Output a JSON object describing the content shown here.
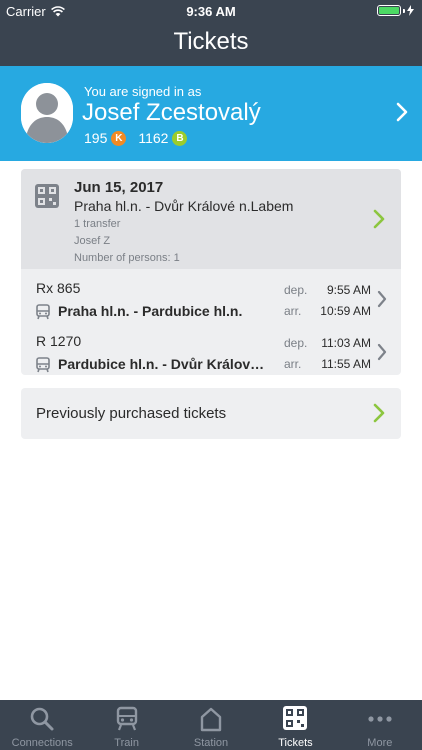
{
  "status_bar": {
    "carrier": "Carrier",
    "time": "9:36 AM"
  },
  "nav": {
    "title": "Tickets"
  },
  "profile": {
    "signed_in_text": "You are signed in as",
    "name": "Josef Zcestovalý",
    "points_k": "195",
    "badge_k": "K",
    "points_b": "1162",
    "badge_b": "B"
  },
  "ticket": {
    "date": "Jun 15, 2017",
    "route": "Praha hl.n. - Dvůr Králové n.Labem",
    "transfers": "1 transfer",
    "passenger": "Josef Z",
    "persons": "Number of persons: 1",
    "legs": [
      {
        "train": "Rx 865",
        "route": "Praha hl.n. - Pardubice hl.n.",
        "dep_label": "dep.",
        "dep_time": "9:55 AM",
        "arr_label": "arr.",
        "arr_time": "10:59 AM"
      },
      {
        "train": "R 1270",
        "route": "Pardubice hl.n. - Dvůr Králov…",
        "dep_label": "dep.",
        "dep_time": "11:03 AM",
        "arr_label": "arr.",
        "arr_time": "11:55 AM"
      }
    ]
  },
  "previous": {
    "label": "Previously purchased tickets"
  },
  "tabs": [
    {
      "label": "Connections",
      "icon": "search-icon"
    },
    {
      "label": "Train",
      "icon": "train-icon"
    },
    {
      "label": "Station",
      "icon": "station-icon"
    },
    {
      "label": "Tickets",
      "icon": "qr-icon",
      "active": true
    },
    {
      "label": "More",
      "icon": "more-icon"
    }
  ],
  "colors": {
    "bar": "#3a4450",
    "accent": "#27a9e1",
    "green": "#8cc63f",
    "badge_k": "#f08a24",
    "badge_b": "#9ccc2c"
  }
}
